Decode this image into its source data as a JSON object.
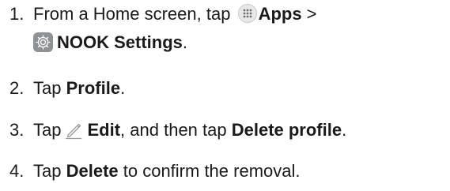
{
  "steps": [
    {
      "number": "1.",
      "parts": {
        "t1": "From a Home screen, tap",
        "b1": "Apps",
        "t2": " >",
        "b2": "NOOK Settings",
        "t3": "."
      },
      "icons": [
        "apps-icon",
        "settings-gear-icon"
      ]
    },
    {
      "number": "2.",
      "parts": {
        "t1": "Tap ",
        "b1": "Profile",
        "t2": "."
      }
    },
    {
      "number": "3.",
      "parts": {
        "t1": "Tap",
        "b1": "Edit",
        "t2": ", and then tap ",
        "b2": "Delete profile",
        "t3": "."
      },
      "icons": [
        "pencil-edit-icon"
      ]
    },
    {
      "number": "4.",
      "parts": {
        "t1": "Tap ",
        "b1": "Delete",
        "t2": " to confirm the removal."
      }
    }
  ],
  "colors": {
    "text": "#1a1a1a",
    "icon_tile_gray": "#8d9295",
    "apps_icon_bg": "#e8e8e8"
  }
}
